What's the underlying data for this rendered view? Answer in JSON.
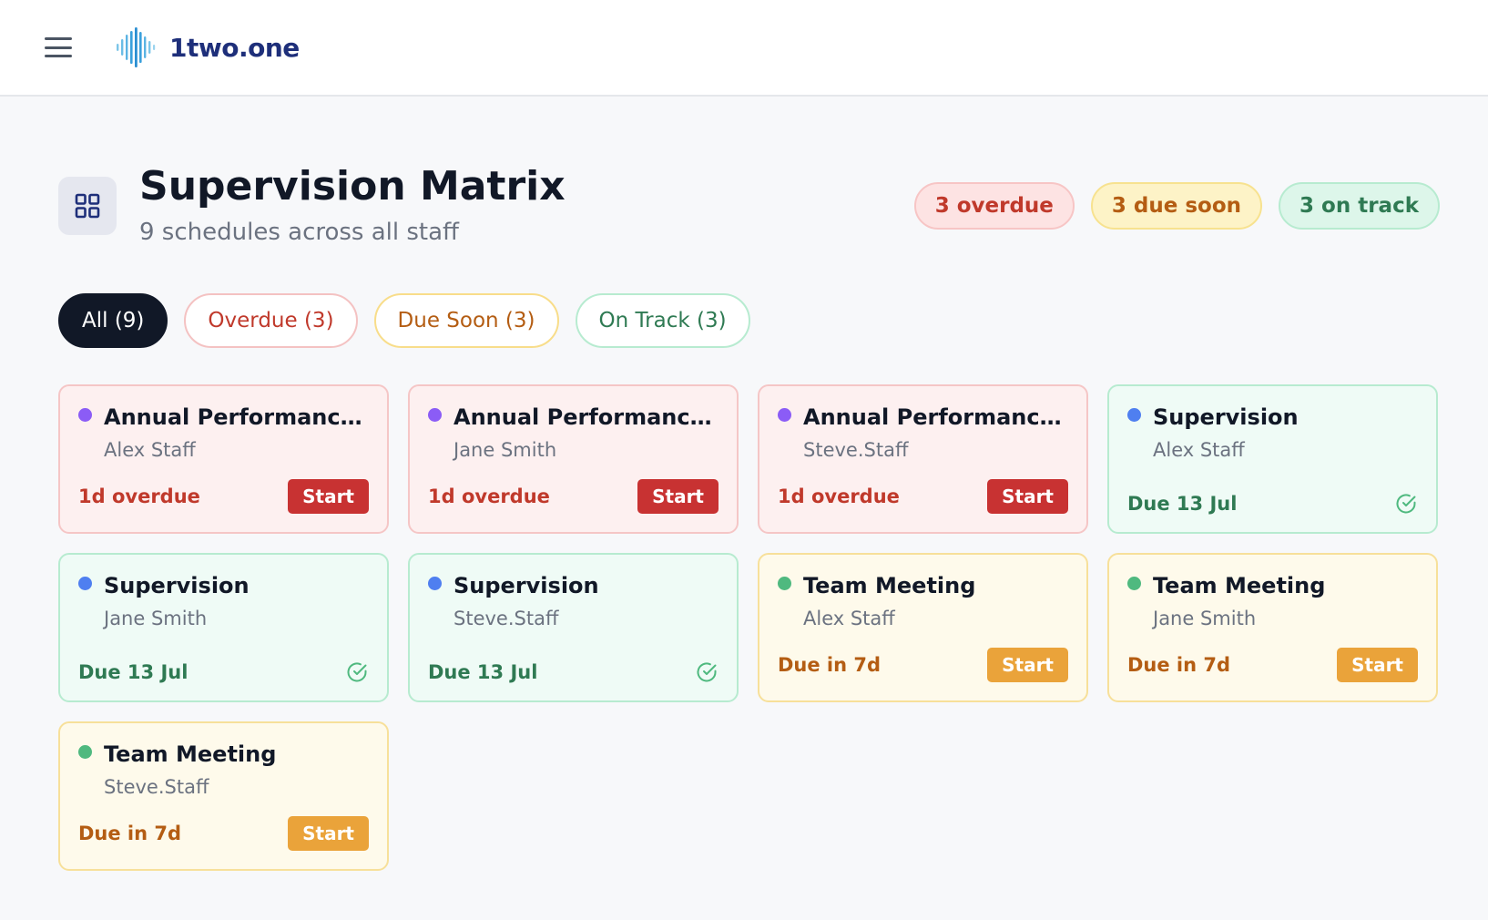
{
  "app": {
    "brand_name": "1two.one"
  },
  "page": {
    "title": "Supervision Matrix",
    "subtitle": "9 schedules across all staff"
  },
  "summary": {
    "overdue": "3 overdue",
    "due_soon": "3 due soon",
    "on_track": "3 on track"
  },
  "filters": [
    {
      "label": "All (9)",
      "key": "all",
      "active": true
    },
    {
      "label": "Overdue (3)",
      "key": "overdue",
      "active": false
    },
    {
      "label": "Due Soon (3)",
      "key": "soon",
      "active": false
    },
    {
      "label": "On Track (3)",
      "key": "track",
      "active": false
    }
  ],
  "colors": {
    "overdue": "#c83232",
    "due_soon": "#eaa33a",
    "on_track": "#2f7a53",
    "dot_annual": "#8b5cf6",
    "dot_supervision": "#4f7ff0",
    "dot_team": "#4fb97f"
  },
  "start_label": "Start",
  "cards": [
    {
      "title": "Annual Performance Re...",
      "person": "Alex Staff",
      "status": "1d overdue",
      "state": "red",
      "dot": "purple",
      "action": "start"
    },
    {
      "title": "Annual Performance Re...",
      "person": "Jane Smith",
      "status": "1d overdue",
      "state": "red",
      "dot": "purple",
      "action": "start"
    },
    {
      "title": "Annual Performance Re...",
      "person": "Steve.Staff",
      "status": "1d overdue",
      "state": "red",
      "dot": "purple",
      "action": "start"
    },
    {
      "title": "Supervision",
      "person": "Alex Staff",
      "status": "Due 13 Jul",
      "state": "green",
      "dot": "blue",
      "action": "check"
    },
    {
      "title": "Supervision",
      "person": "Jane Smith",
      "status": "Due 13 Jul",
      "state": "green",
      "dot": "blue",
      "action": "check"
    },
    {
      "title": "Supervision",
      "person": "Steve.Staff",
      "status": "Due 13 Jul",
      "state": "green",
      "dot": "blue",
      "action": "check"
    },
    {
      "title": "Team Meeting",
      "person": "Alex Staff",
      "status": "Due in 7d",
      "state": "amber",
      "dot": "teal",
      "action": "start"
    },
    {
      "title": "Team Meeting",
      "person": "Jane Smith",
      "status": "Due in 7d",
      "state": "amber",
      "dot": "teal",
      "action": "start"
    },
    {
      "title": "Team Meeting",
      "person": "Steve.Staff",
      "status": "Due in 7d",
      "state": "amber",
      "dot": "teal",
      "action": "start"
    }
  ]
}
